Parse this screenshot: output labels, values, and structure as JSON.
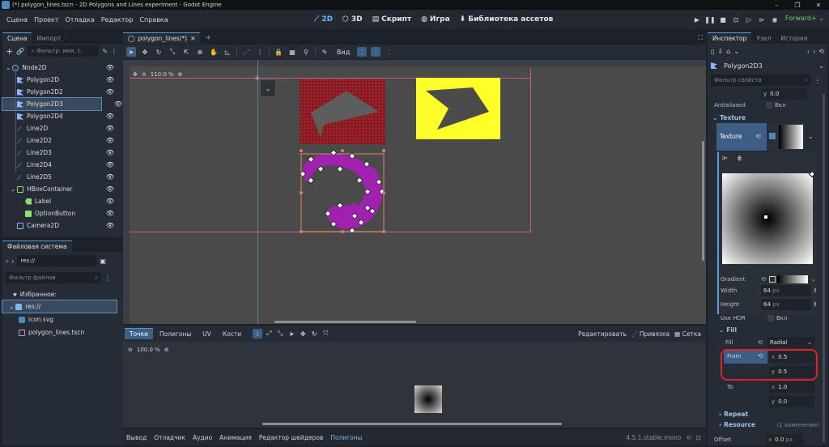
{
  "window": {
    "title": "(*) polygon_lines.tscn - 2D Polygons and Lines experiment - Godot Engine"
  },
  "menu": [
    "Сцена",
    "Проект",
    "Отладка",
    "Редактор",
    "Справка"
  ],
  "main_screens": [
    {
      "label": "2D",
      "icon": "2d-icon"
    },
    {
      "label": "3D",
      "icon": "3d-icon"
    },
    {
      "label": "Скрипт",
      "icon": "script-icon"
    },
    {
      "label": "Игра",
      "icon": "game-icon"
    },
    {
      "label": "Библиотека ассетов",
      "icon": "asset-library-icon"
    }
  ],
  "renderer": "Forward+",
  "scene_dock": {
    "tabs": [
      "Сцена",
      "Импорт"
    ],
    "filter_placeholder": "Фильтр: имя, t:",
    "nodes": [
      {
        "name": "Node2D",
        "icon_color": "#7aa8f0"
      },
      {
        "name": "Polygon2D",
        "icon_color": "#8eb3ff"
      },
      {
        "name": "Polygon2D2",
        "icon_color": "#8eb3ff"
      },
      {
        "name": "Polygon2D3",
        "icon_color": "#8eb3ff"
      },
      {
        "name": "Polygon2D4",
        "icon_color": "#8eb3ff"
      },
      {
        "name": "Line2D",
        "icon_color": "#8eb3ff"
      },
      {
        "name": "Line2D2",
        "icon_color": "#8eb3ff"
      },
      {
        "name": "Line2D3",
        "icon_color": "#8eb3ff"
      },
      {
        "name": "Line2D4",
        "icon_color": "#8eb3ff"
      },
      {
        "name": "Line2D5",
        "icon_color": "#8eb3ff"
      },
      {
        "name": "HBoxContainer",
        "icon_color": "#8fe06b"
      },
      {
        "name": "Label",
        "icon_color": "#8fe06b"
      },
      {
        "name": "OptionButton",
        "icon_color": "#8fe06b"
      },
      {
        "name": "Camera2D",
        "icon_color": "#8eb3ff"
      }
    ]
  },
  "filesystem_dock": {
    "title": "Файловая система",
    "path": "res://",
    "filter_placeholder": "Фильтр файлов",
    "favorites": "Избранное:",
    "items": [
      {
        "name": "res://",
        "type": "folder"
      },
      {
        "name": "icon.svg",
        "type": "file"
      },
      {
        "name": "polygon_lines.tscn",
        "type": "file"
      }
    ]
  },
  "editor_tab": "polygon_lines(*)",
  "viewport": {
    "zoom": "110.0 %",
    "view_menu": "Вид"
  },
  "bottom_editor": {
    "tabs": [
      "Точки",
      "Полигоны",
      "UV",
      "Кости"
    ],
    "edit_label": "Редактировать",
    "snap_label": "Привязка",
    "grid_label": "Сетка",
    "zoom": "100.0 %"
  },
  "bottom_bar": {
    "tabs": [
      "Вывод",
      "Отладчик",
      "Аудио",
      "Анимация",
      "Редактор шейдеров",
      "Полигоны"
    ],
    "version": "4.5.1.stable.mono"
  },
  "inspector": {
    "tabs": [
      "Инспектор",
      "Узел",
      "История"
    ],
    "node_name": "Polygon2D3",
    "filter_placeholder": "Фильтр свойств",
    "top_y": "0.0",
    "antialiased_label": "Antialiased",
    "antialiased_value": "Вкл",
    "texture_section": "Texture",
    "texture_label": "Texture",
    "gradient_label": "Gradient",
    "width_label": "Width",
    "width_value": "64",
    "height_label": "Height",
    "height_value": "64",
    "unit_px": "px",
    "use_hdr_label": "Use HDR",
    "use_hdr_value": "Вкл",
    "fill_section": "Fill",
    "fill_label": "Fill",
    "fill_value": "Radial",
    "from_label": "From",
    "from_x": "0.5",
    "from_y": "0.5",
    "to_label": "To",
    "to_x": "1.0",
    "to_y": "0.0",
    "repeat_section": "Repeat",
    "resource_section": "Resource",
    "resource_note": "(1 изменение)",
    "offset_label": "Offset",
    "offset_x": "0.0",
    "offset_unit": "px"
  },
  "colors": {
    "accent": "#5b9bd5",
    "highlight_box": "#e0202a",
    "yellow_panel": "#ffff2a",
    "purple_polygon": "#a020b0",
    "red_texture": "#8b1c24"
  }
}
